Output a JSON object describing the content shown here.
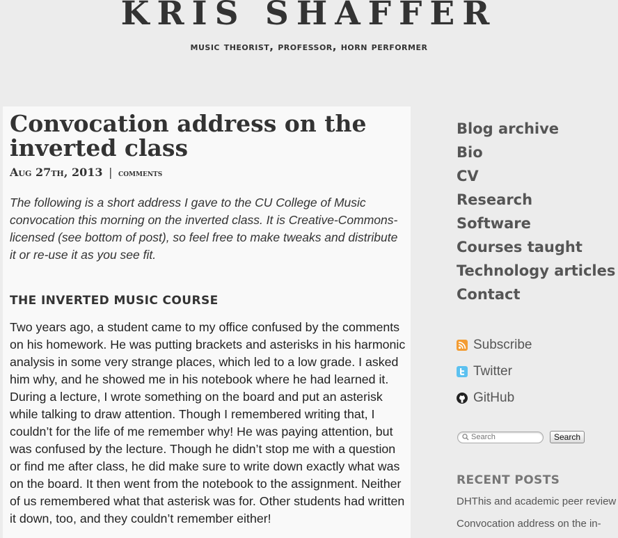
{
  "header": {
    "title": "KRIS SHAFFER",
    "tagline": "music theorist, professor, horn performer"
  },
  "post": {
    "title": "Convocation address on the inverted class",
    "date": "Aug 27th, 2013",
    "separator": "|",
    "comments_label": "comments",
    "intro": "The following is a short address I gave to the CU College of Music convocation this morning on the inverted class. It is Creative-Commons-licensed (see bottom of post), so feel free to make tweaks and distribute it or re-use it as you see fit.",
    "section_heading": "THE INVERTED MUSIC COURSE",
    "body": "Two years ago, a student came to my office confused by the comments on his homework. He was putting brackets and asterisks in his harmonic analysis in some very strange places, which led to a low grade. I asked him why, and he showed me in his notebook where he had learned it. During a lecture, I wrote something on the board and put an asterisk while talking to draw attention. Though I remembered writing that, I couldn’t for the life of me remember why! He was paying attention, but was confused by the lecture. Though he didn’t stop me with a question or find me after class, he did make sure to write down exactly what was on the board. It then went from the notebook to the assignment. Neither of us remembered what that asterisk was for. Other students had written it down, too, and they couldn’t remember either!"
  },
  "sidebar": {
    "nav": [
      {
        "label": "Blog archive"
      },
      {
        "label": "Bio"
      },
      {
        "label": "CV"
      },
      {
        "label": "Research"
      },
      {
        "label": "Software"
      },
      {
        "label": "Courses taught"
      },
      {
        "label": "Technology articles"
      },
      {
        "label": "Contact"
      }
    ],
    "social": [
      {
        "label": "Subscribe",
        "icon": "rss-icon"
      },
      {
        "label": "Twitter",
        "icon": "twitter-icon"
      },
      {
        "label": "GitHub",
        "icon": "github-icon"
      }
    ],
    "search": {
      "placeholder": "Search",
      "button_label": "Search"
    },
    "recent_heading": "RECENT POSTS",
    "recent_posts": [
      {
        "label": "DHThis and academic peer review"
      },
      {
        "label": "Convocation address on the in-"
      }
    ]
  },
  "colors": {
    "background": "#ececec",
    "content_background": "#f9f9f9",
    "rss": "#f39c32",
    "twitter": "#5cc1f0"
  }
}
